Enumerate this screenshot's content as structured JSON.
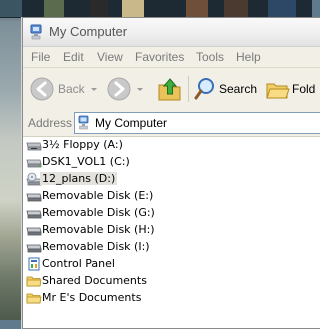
{
  "window": {
    "title": "My Computer"
  },
  "menubar": {
    "items": [
      {
        "label": "File"
      },
      {
        "label": "Edit"
      },
      {
        "label": "View"
      },
      {
        "label": "Favorites"
      },
      {
        "label": "Tools"
      },
      {
        "label": "Help"
      }
    ]
  },
  "toolbar": {
    "back_label": "Back",
    "search_label": "Search",
    "folders_label": "Fold"
  },
  "address": {
    "label": "Address",
    "value": "My Computer"
  },
  "items": [
    {
      "label": "3½ Floppy (A:)",
      "icon": "floppy-drive-icon"
    },
    {
      "label": "DSK1_VOL1 (C:)",
      "icon": "hard-drive-icon"
    },
    {
      "label": "12_plans (D:)",
      "icon": "cd-drive-icon"
    },
    {
      "label": "Removable Disk (E:)",
      "icon": "removable-disk-icon"
    },
    {
      "label": "Removable Disk (G:)",
      "icon": "removable-disk-icon"
    },
    {
      "label": "Removable Disk (H:)",
      "icon": "removable-disk-icon"
    },
    {
      "label": "Removable Disk (I:)",
      "icon": "removable-disk-icon"
    },
    {
      "label": "Control Panel",
      "icon": "control-panel-icon"
    },
    {
      "label": "Shared Documents",
      "icon": "folder-icon"
    },
    {
      "label": "Mr E's Documents",
      "icon": "folder-icon"
    }
  ],
  "colors": {
    "window_bg": "#ece9d8",
    "content_bg": "#ffffff",
    "address_border": "#7f9db9",
    "selected_bg": "#e3e2dc"
  }
}
